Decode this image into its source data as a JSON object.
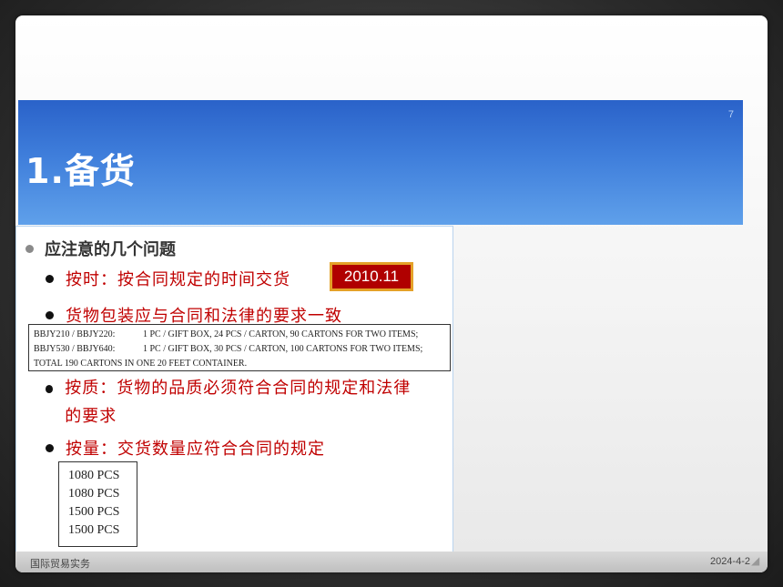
{
  "slide": {
    "number": "7",
    "title": "1.备货",
    "bullet_main": "应注意的几个问题",
    "items": [
      {
        "text": "按时：按合同规定的时间交货"
      },
      {
        "text": "货物包装应与合同和法律的要求一致"
      },
      {
        "text": "按质：货物的品质必须符合合同的规定和法律的要求"
      },
      {
        "text": "按量：交货数量应符合合同的规定"
      }
    ],
    "badge": "2010.11",
    "packing": [
      {
        "code": "BBJY210 / BBJY220:",
        "desc": "1 PC / GIFT BOX, 24 PCS / CARTON, 90 CARTONS FOR TWO ITEMS;"
      },
      {
        "code": "BBJY530 / BBJY640:",
        "desc": "1 PC / GIFT BOX, 30 PCS / CARTON, 100 CARTONS FOR TWO ITEMS;"
      },
      {
        "code": "",
        "desc": "TOTAL 190 CARTONS IN ONE 20 FEET CONTAINER."
      }
    ],
    "quantities": [
      "1080 PCS",
      "1080 PCS",
      "1500 PCS",
      "1500 PCS"
    ]
  },
  "footer": {
    "left": "国际贸易实务",
    "right": "2024-4-2"
  }
}
